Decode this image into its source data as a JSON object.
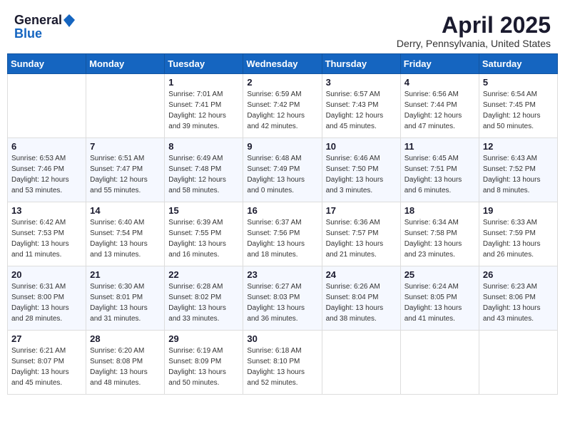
{
  "header": {
    "logo_general": "General",
    "logo_blue": "Blue",
    "month": "April 2025",
    "location": "Derry, Pennsylvania, United States"
  },
  "weekdays": [
    "Sunday",
    "Monday",
    "Tuesday",
    "Wednesday",
    "Thursday",
    "Friday",
    "Saturday"
  ],
  "weeks": [
    [
      {
        "day": "",
        "sunrise": "",
        "sunset": "",
        "daylight": ""
      },
      {
        "day": "",
        "sunrise": "",
        "sunset": "",
        "daylight": ""
      },
      {
        "day": "1",
        "sunrise": "Sunrise: 7:01 AM",
        "sunset": "Sunset: 7:41 PM",
        "daylight": "Daylight: 12 hours and 39 minutes."
      },
      {
        "day": "2",
        "sunrise": "Sunrise: 6:59 AM",
        "sunset": "Sunset: 7:42 PM",
        "daylight": "Daylight: 12 hours and 42 minutes."
      },
      {
        "day": "3",
        "sunrise": "Sunrise: 6:57 AM",
        "sunset": "Sunset: 7:43 PM",
        "daylight": "Daylight: 12 hours and 45 minutes."
      },
      {
        "day": "4",
        "sunrise": "Sunrise: 6:56 AM",
        "sunset": "Sunset: 7:44 PM",
        "daylight": "Daylight: 12 hours and 47 minutes."
      },
      {
        "day": "5",
        "sunrise": "Sunrise: 6:54 AM",
        "sunset": "Sunset: 7:45 PM",
        "daylight": "Daylight: 12 hours and 50 minutes."
      }
    ],
    [
      {
        "day": "6",
        "sunrise": "Sunrise: 6:53 AM",
        "sunset": "Sunset: 7:46 PM",
        "daylight": "Daylight: 12 hours and 53 minutes."
      },
      {
        "day": "7",
        "sunrise": "Sunrise: 6:51 AM",
        "sunset": "Sunset: 7:47 PM",
        "daylight": "Daylight: 12 hours and 55 minutes."
      },
      {
        "day": "8",
        "sunrise": "Sunrise: 6:49 AM",
        "sunset": "Sunset: 7:48 PM",
        "daylight": "Daylight: 12 hours and 58 minutes."
      },
      {
        "day": "9",
        "sunrise": "Sunrise: 6:48 AM",
        "sunset": "Sunset: 7:49 PM",
        "daylight": "Daylight: 13 hours and 0 minutes."
      },
      {
        "day": "10",
        "sunrise": "Sunrise: 6:46 AM",
        "sunset": "Sunset: 7:50 PM",
        "daylight": "Daylight: 13 hours and 3 minutes."
      },
      {
        "day": "11",
        "sunrise": "Sunrise: 6:45 AM",
        "sunset": "Sunset: 7:51 PM",
        "daylight": "Daylight: 13 hours and 6 minutes."
      },
      {
        "day": "12",
        "sunrise": "Sunrise: 6:43 AM",
        "sunset": "Sunset: 7:52 PM",
        "daylight": "Daylight: 13 hours and 8 minutes."
      }
    ],
    [
      {
        "day": "13",
        "sunrise": "Sunrise: 6:42 AM",
        "sunset": "Sunset: 7:53 PM",
        "daylight": "Daylight: 13 hours and 11 minutes."
      },
      {
        "day": "14",
        "sunrise": "Sunrise: 6:40 AM",
        "sunset": "Sunset: 7:54 PM",
        "daylight": "Daylight: 13 hours and 13 minutes."
      },
      {
        "day": "15",
        "sunrise": "Sunrise: 6:39 AM",
        "sunset": "Sunset: 7:55 PM",
        "daylight": "Daylight: 13 hours and 16 minutes."
      },
      {
        "day": "16",
        "sunrise": "Sunrise: 6:37 AM",
        "sunset": "Sunset: 7:56 PM",
        "daylight": "Daylight: 13 hours and 18 minutes."
      },
      {
        "day": "17",
        "sunrise": "Sunrise: 6:36 AM",
        "sunset": "Sunset: 7:57 PM",
        "daylight": "Daylight: 13 hours and 21 minutes."
      },
      {
        "day": "18",
        "sunrise": "Sunrise: 6:34 AM",
        "sunset": "Sunset: 7:58 PM",
        "daylight": "Daylight: 13 hours and 23 minutes."
      },
      {
        "day": "19",
        "sunrise": "Sunrise: 6:33 AM",
        "sunset": "Sunset: 7:59 PM",
        "daylight": "Daylight: 13 hours and 26 minutes."
      }
    ],
    [
      {
        "day": "20",
        "sunrise": "Sunrise: 6:31 AM",
        "sunset": "Sunset: 8:00 PM",
        "daylight": "Daylight: 13 hours and 28 minutes."
      },
      {
        "day": "21",
        "sunrise": "Sunrise: 6:30 AM",
        "sunset": "Sunset: 8:01 PM",
        "daylight": "Daylight: 13 hours and 31 minutes."
      },
      {
        "day": "22",
        "sunrise": "Sunrise: 6:28 AM",
        "sunset": "Sunset: 8:02 PM",
        "daylight": "Daylight: 13 hours and 33 minutes."
      },
      {
        "day": "23",
        "sunrise": "Sunrise: 6:27 AM",
        "sunset": "Sunset: 8:03 PM",
        "daylight": "Daylight: 13 hours and 36 minutes."
      },
      {
        "day": "24",
        "sunrise": "Sunrise: 6:26 AM",
        "sunset": "Sunset: 8:04 PM",
        "daylight": "Daylight: 13 hours and 38 minutes."
      },
      {
        "day": "25",
        "sunrise": "Sunrise: 6:24 AM",
        "sunset": "Sunset: 8:05 PM",
        "daylight": "Daylight: 13 hours and 41 minutes."
      },
      {
        "day": "26",
        "sunrise": "Sunrise: 6:23 AM",
        "sunset": "Sunset: 8:06 PM",
        "daylight": "Daylight: 13 hours and 43 minutes."
      }
    ],
    [
      {
        "day": "27",
        "sunrise": "Sunrise: 6:21 AM",
        "sunset": "Sunset: 8:07 PM",
        "daylight": "Daylight: 13 hours and 45 minutes."
      },
      {
        "day": "28",
        "sunrise": "Sunrise: 6:20 AM",
        "sunset": "Sunset: 8:08 PM",
        "daylight": "Daylight: 13 hours and 48 minutes."
      },
      {
        "day": "29",
        "sunrise": "Sunrise: 6:19 AM",
        "sunset": "Sunset: 8:09 PM",
        "daylight": "Daylight: 13 hours and 50 minutes."
      },
      {
        "day": "30",
        "sunrise": "Sunrise: 6:18 AM",
        "sunset": "Sunset: 8:10 PM",
        "daylight": "Daylight: 13 hours and 52 minutes."
      },
      {
        "day": "",
        "sunrise": "",
        "sunset": "",
        "daylight": ""
      },
      {
        "day": "",
        "sunrise": "",
        "sunset": "",
        "daylight": ""
      },
      {
        "day": "",
        "sunrise": "",
        "sunset": "",
        "daylight": ""
      }
    ]
  ]
}
